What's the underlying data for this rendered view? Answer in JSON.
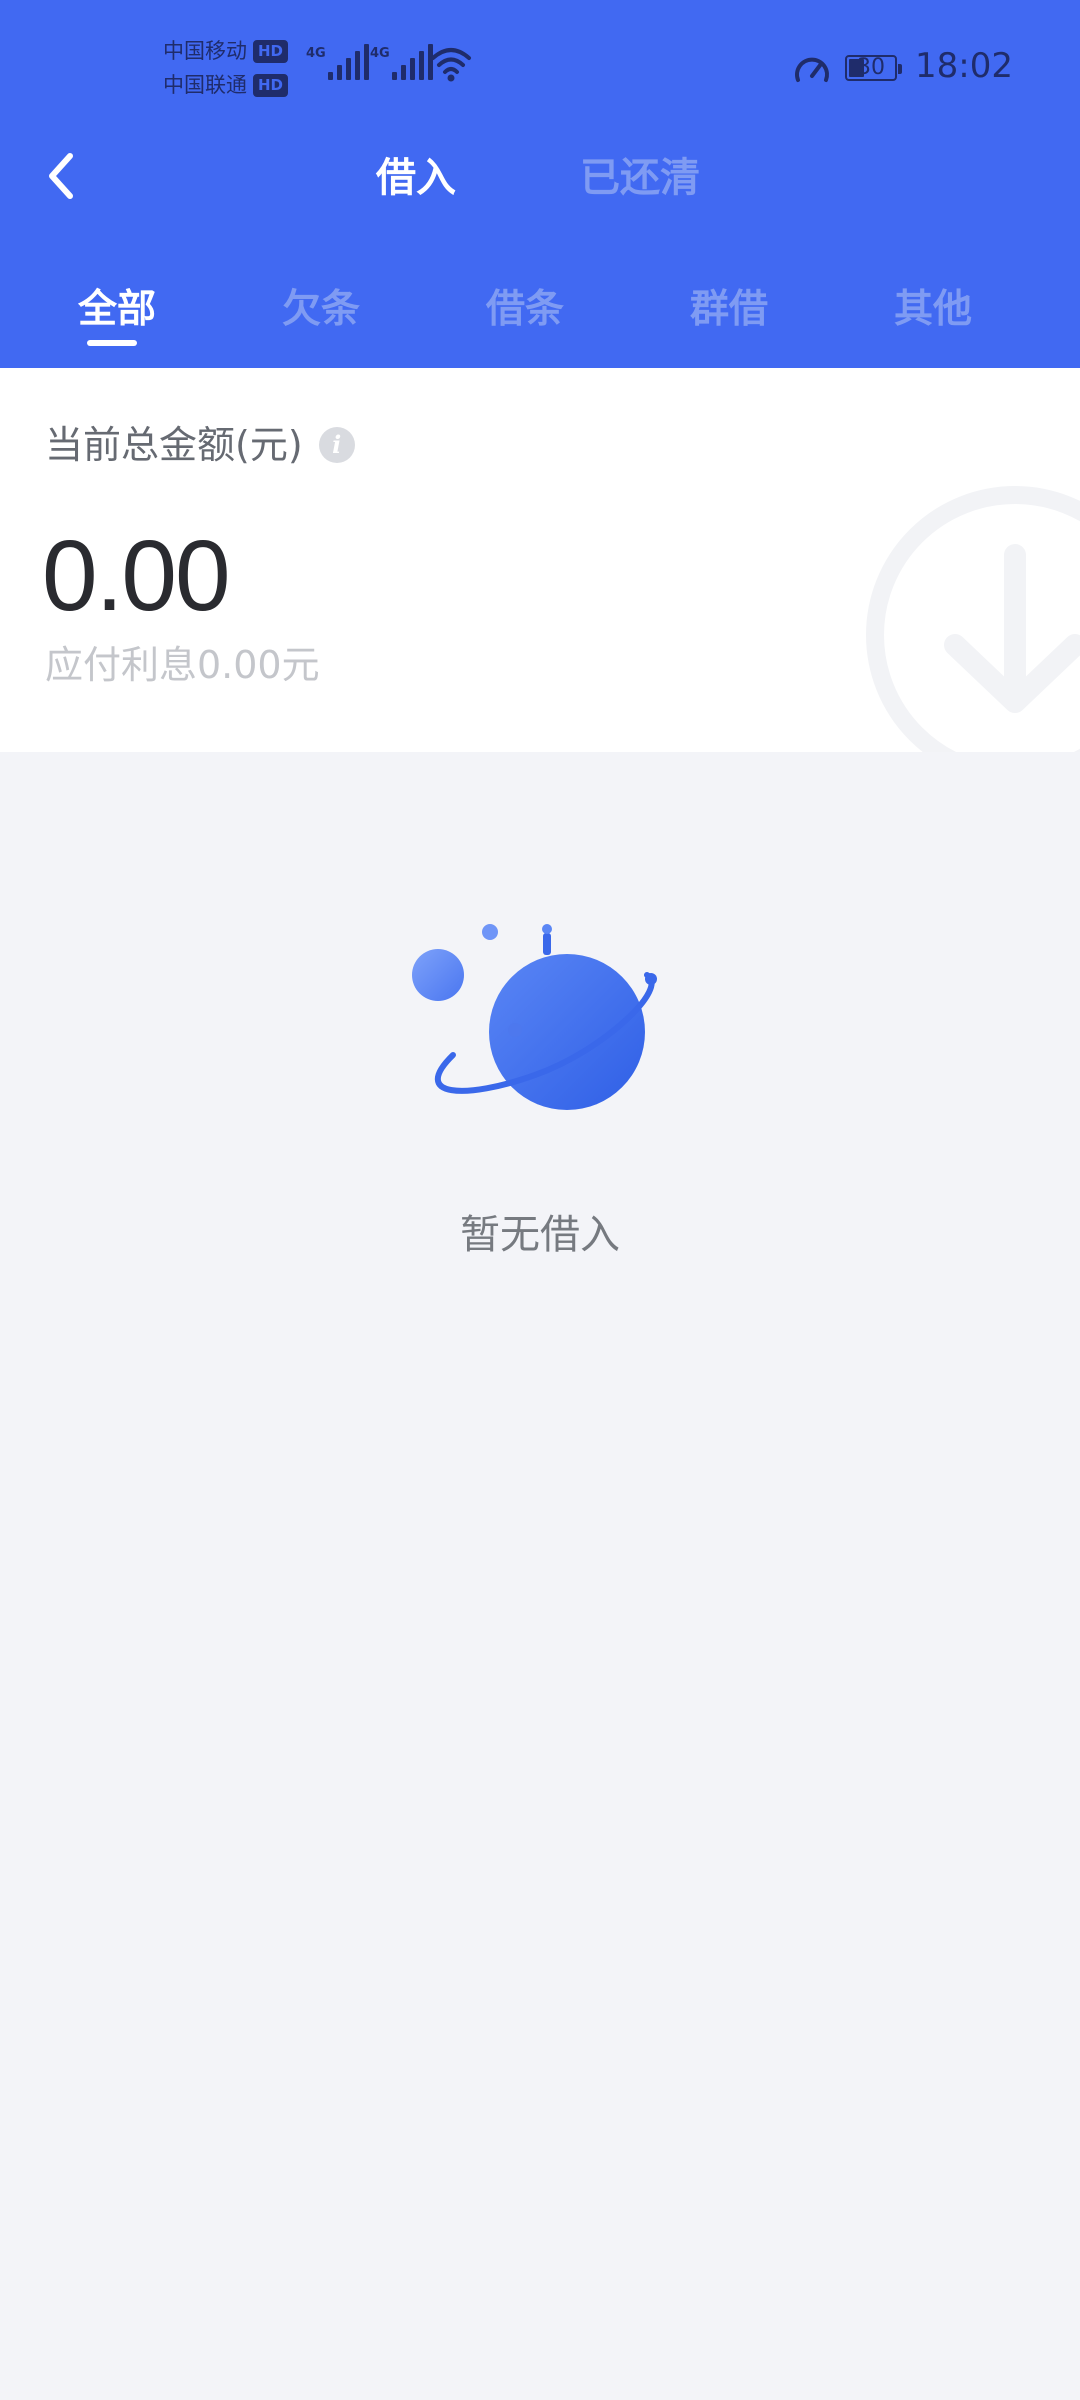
{
  "status_bar": {
    "carrier_1": "中国移动",
    "carrier_2": "中国联通",
    "hd_badge": "HD",
    "network_tag": "4G",
    "battery_level": "30",
    "time": "18:02"
  },
  "nav": {
    "tabs": [
      {
        "label": "借入",
        "active": true
      },
      {
        "label": "已还清",
        "active": false
      }
    ]
  },
  "sub_tabs": [
    {
      "label": "全部",
      "active": true
    },
    {
      "label": "欠条",
      "active": false
    },
    {
      "label": "借条",
      "active": false
    },
    {
      "label": "群借",
      "active": false
    },
    {
      "label": "其他",
      "active": false
    }
  ],
  "summary": {
    "label": "当前总金额(元)",
    "info_icon": "i",
    "amount": "0.00",
    "interest": "应付利息0.00元"
  },
  "empty_state": {
    "text": "暂无借入"
  },
  "colors": {
    "brand": "#4169f2",
    "inactive_tab": "#7f9bf3",
    "page_bg": "#f3f4f8"
  }
}
